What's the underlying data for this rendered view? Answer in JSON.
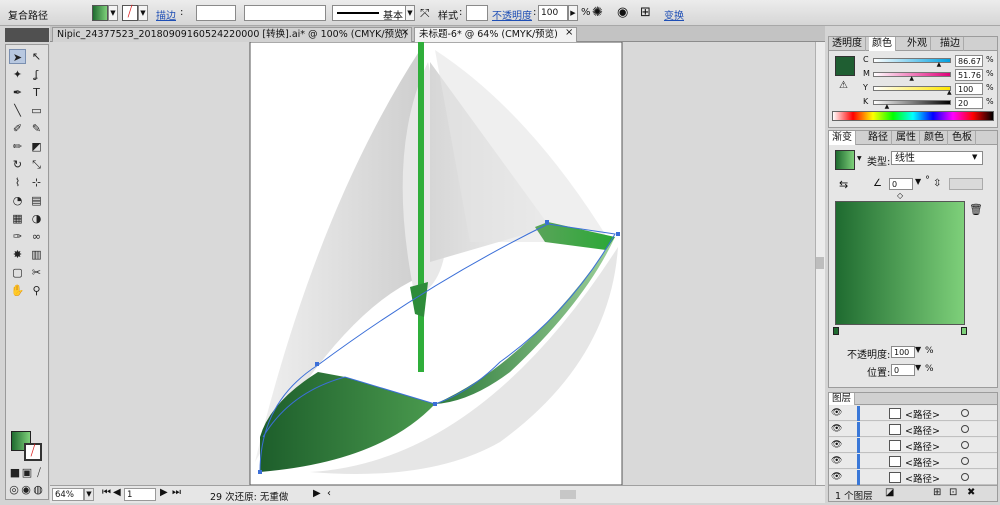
{
  "control_bar": {
    "object_label": "复合路径",
    "stroke_label": "描边",
    "stroke_sep": ":",
    "style_label": "样式",
    "style_sep": ":",
    "brush_label": "基本",
    "opacity_label": "不透明度",
    "opacity_value": "100",
    "opacity_unit": "%",
    "transform_label": "变换"
  },
  "tabs": [
    {
      "label": "Nipic_24377523_20180909160524220000 [转换].ai* @ 100% (CMYK/预览)",
      "close": "×"
    },
    {
      "label": "未标题-6* @ 64% (CMYK/预览)",
      "close": "×"
    }
  ],
  "toolbar": {
    "tools": [
      "selection-tool",
      "direct-selection-tool",
      "magic-wand-tool",
      "lasso-tool",
      "pen-tool",
      "type-tool",
      "line-tool",
      "rectangle-tool",
      "paintbrush-tool",
      "pencil-tool",
      "blob-brush-tool",
      "eraser-tool",
      "rotate-tool",
      "scale-tool",
      "width-tool",
      "free-transform-tool",
      "shape-builder-tool",
      "perspective-tool",
      "mesh-tool",
      "gradient-tool",
      "eyedropper-tool",
      "blend-tool",
      "symbol-sprayer-tool",
      "column-graph-tool",
      "artboard-tool",
      "slice-tool",
      "hand-tool",
      "zoom-tool"
    ],
    "glyphs": [
      "➤",
      "↖",
      "✦",
      "ʆ",
      "✒",
      "T",
      "╲",
      "▭",
      "✐",
      "✎",
      "✏",
      "◩",
      "↻",
      "⤡",
      "⌇",
      "⊹",
      "◔",
      "▤",
      "▦",
      "◑",
      "✑",
      "∞",
      "✸",
      "▥",
      "▢",
      "✂",
      "✋",
      "⚲"
    ]
  },
  "status_bar": {
    "zoom": "64%",
    "page": "1",
    "undo": "29 次还原: 无重做"
  },
  "color_panel": {
    "tabs": [
      "透明度",
      "颜色",
      "外观",
      "描边"
    ],
    "active_tab": "颜色",
    "channels": [
      {
        "name": "C",
        "value": "86.67",
        "fraction": 0.8667
      },
      {
        "name": "M",
        "value": "51.76",
        "fraction": 0.5176
      },
      {
        "name": "Y",
        "value": "100",
        "fraction": 1.0
      },
      {
        "name": "K",
        "value": "20",
        "fraction": 0.2
      }
    ],
    "fill_color": "#1f5e32"
  },
  "gradient_panel": {
    "tabs": [
      "渐变",
      "路径",
      "属性",
      "颜色",
      "色板"
    ],
    "active_tab": "渐变",
    "type_label": "类型:",
    "type_value": "线性",
    "angle_value": "0",
    "angle_unit": "°",
    "opacity_label": "不透明度:",
    "opacity_value": "100",
    "opacity_unit": "%",
    "location_label": "位置:",
    "location_value": "0",
    "location_unit": "%",
    "gradient_start": "#1f6b30",
    "gradient_end": "#7ed07a"
  },
  "layers_panel": {
    "tab": "图层",
    "rows": [
      "<路径>",
      "<路径>",
      "<路径>",
      "<路径>",
      "<路径>"
    ],
    "footer_count": "1 个图层"
  },
  "colors": {
    "accent": "#1e6b2f",
    "mast": "#2fae3a",
    "selection": "#3b6fd8"
  }
}
